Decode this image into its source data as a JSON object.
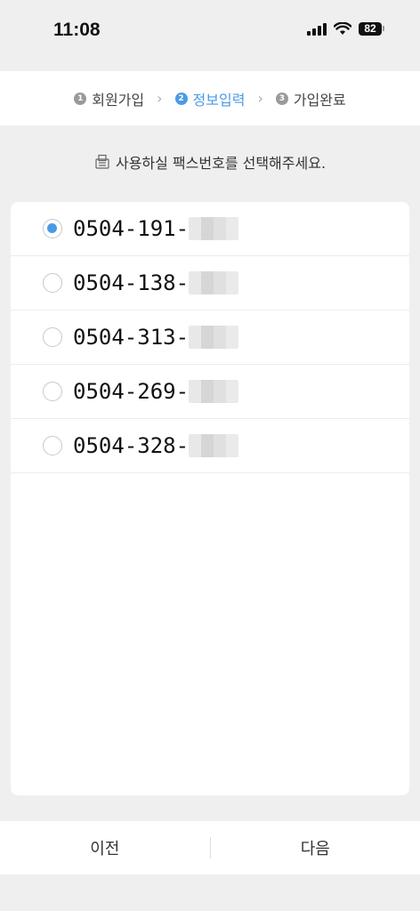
{
  "status": {
    "time": "11:08",
    "battery": "82"
  },
  "steps": [
    {
      "num": "1",
      "label": "회원가입"
    },
    {
      "num": "2",
      "label": "정보입력"
    },
    {
      "num": "3",
      "label": "가입완료"
    }
  ],
  "instruction": "사용하실 팩스번호를 선택해주세요.",
  "fax_options": [
    {
      "prefix": "0504-191-",
      "selected": true
    },
    {
      "prefix": "0504-138-",
      "selected": false
    },
    {
      "prefix": "0504-313-",
      "selected": false
    },
    {
      "prefix": "0504-269-",
      "selected": false
    },
    {
      "prefix": "0504-328-",
      "selected": false
    }
  ],
  "buttons": {
    "prev": "이전",
    "next": "다음"
  },
  "colors": {
    "accent": "#4a9be6"
  }
}
